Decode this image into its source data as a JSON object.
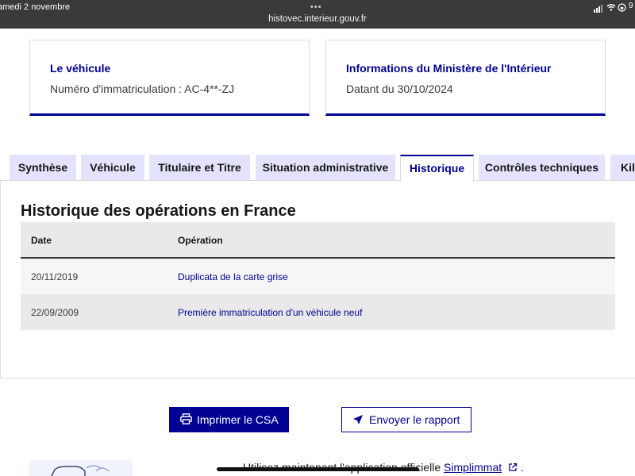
{
  "status_bar": {
    "time": "amedi 2 novembre",
    "dots": "•••",
    "url": "histovec.interieur.gouv.fr",
    "battery": "9"
  },
  "vehicle_card": {
    "title": "Le véhicule",
    "text": "Numéro d'immatriculation : AC-4**-ZJ"
  },
  "ministry_card": {
    "title": "Informations du Ministère de l'Intérieur",
    "text": "Datant du 30/10/2024"
  },
  "tabs": [
    {
      "label": "Synthèse",
      "active": false
    },
    {
      "label": "Véhicule",
      "active": false
    },
    {
      "label": "Titulaire et Titre",
      "active": false
    },
    {
      "label": "Situation administrative",
      "active": false
    },
    {
      "label": "Historique",
      "active": true
    },
    {
      "label": "Contrôles techniques",
      "active": false
    },
    {
      "label": "Kilo",
      "active": false
    }
  ],
  "history": {
    "title": "Historique des opérations en France",
    "columns": [
      "Date",
      "Opération"
    ],
    "rows": [
      {
        "date": "20/11/2019",
        "operation": "Duplicata de la carte grise"
      },
      {
        "date": "22/09/2009",
        "operation": "Première immatriculation d'un véhicule neuf"
      }
    ]
  },
  "actions": {
    "print_label": "Imprimer le CSA",
    "send_label": "Envoyer le rapport"
  },
  "footer": {
    "text": "Utilisez maintenant l'application officielle",
    "link": "Simplimmat",
    "suffix": "."
  },
  "colors": {
    "primary": "#000091",
    "tab_bg": "#e3e3fd",
    "table_head_bg": "#e9e9e9",
    "table_row_alt": "#f6f6f6",
    "topbar": "#3a3a3c"
  }
}
